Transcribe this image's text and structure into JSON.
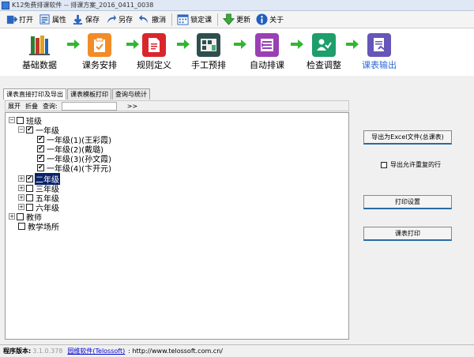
{
  "window": {
    "title": "K12免费排课软件 -- 排课方案_2016_0411_0038"
  },
  "toolbar": {
    "open": "打开",
    "properties": "属性",
    "save": "保存",
    "save_as": "另存",
    "undo": "撤消",
    "lock": "锁定课",
    "update": "更新",
    "about": "关于"
  },
  "workflow": {
    "steps": [
      {
        "label": "基础数据",
        "color": "#2e7d32"
      },
      {
        "label": "课务安排",
        "color": "#f28c28"
      },
      {
        "label": "规则定义",
        "color": "#d9262c"
      },
      {
        "label": "手工预排",
        "color": "#2f4f4f"
      },
      {
        "label": "自动排课",
        "color": "#9b3fb5"
      },
      {
        "label": "检查调整",
        "color": "#1e9e6a"
      },
      {
        "label": "课表输出",
        "color": "#6656b8"
      }
    ],
    "active_color": "#2f6bd6"
  },
  "tabs": [
    "课表直接打印及导出",
    "课表模板打印",
    "查询与统计"
  ],
  "tree_toolbar": {
    "expand": "展开",
    "collapse": "折叠",
    "search": "查询:",
    "more": ">>"
  },
  "tree": {
    "classes": "班级",
    "grade1": "一年级",
    "c1": "一年级(1)(王彩霞)",
    "c2": "一年级(2)(戴璐)",
    "c3": "一年级(3)(孙文霞)",
    "c4": "一年级(4)(卞开元)",
    "grade2": "二年级",
    "grade3": "三年级",
    "grade5": "五年级",
    "grade6": "六年级",
    "teachers": "教师",
    "venues": "教学场所"
  },
  "actions": {
    "export_excel": "导出为Excel文件(总课表)",
    "export_dup": "导出允许重复的行",
    "print_settings": "打印设置",
    "print_timetable": "课表打印"
  },
  "status": {
    "version_label": "程序版本:",
    "version_value": "3.1.0.378",
    "company": "园维软件(Telossoft)",
    "url": ": http://www.telossoft.com.cn/"
  }
}
